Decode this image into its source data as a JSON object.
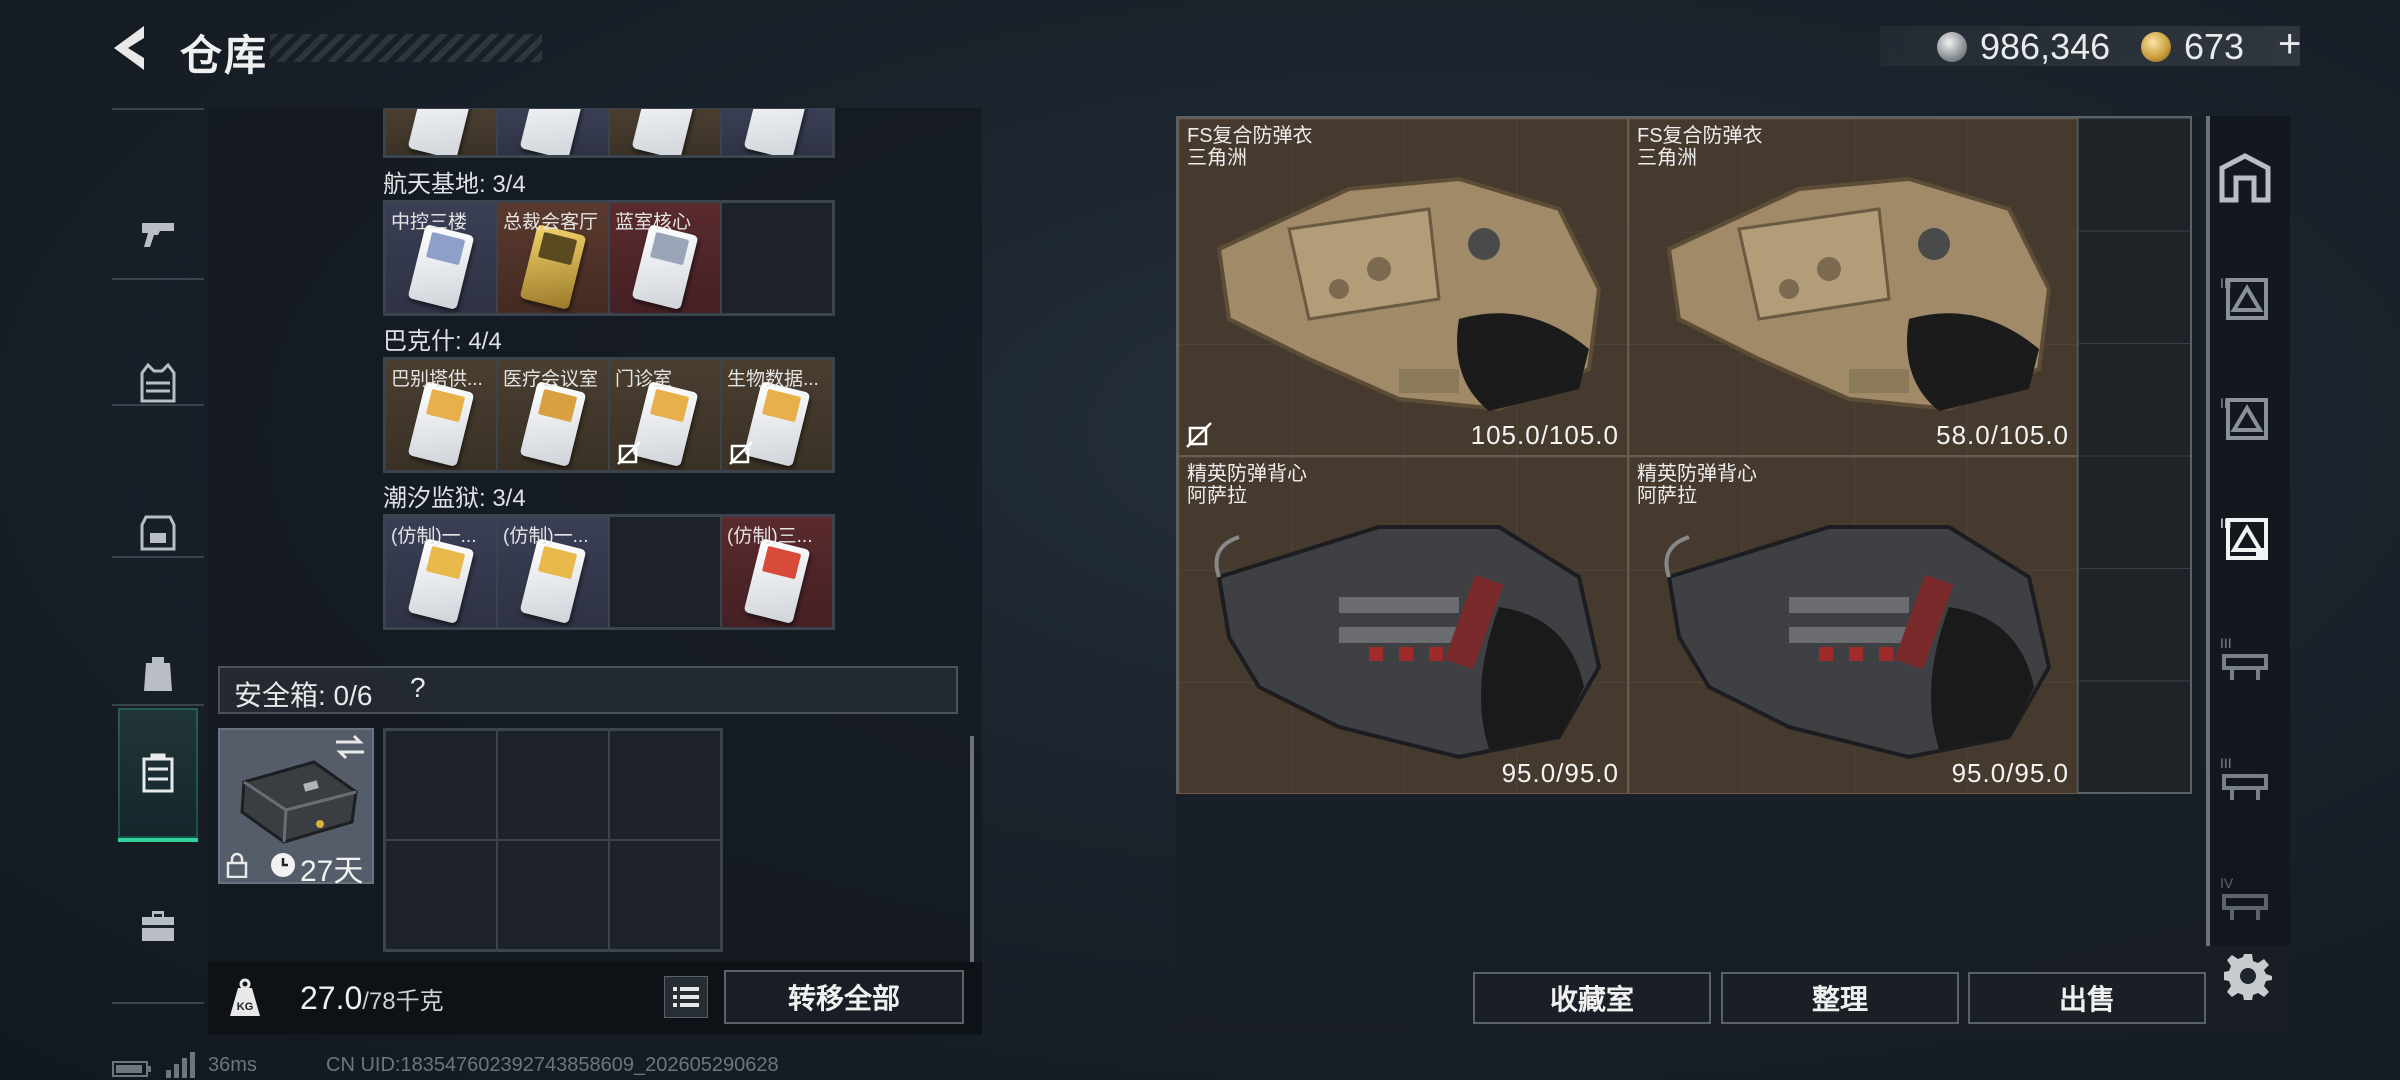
{
  "header": {
    "title": "仓库",
    "silver_amount": "986,346",
    "gold_amount": "673",
    "plus": "+"
  },
  "left_nav": {
    "items": [
      "weapons-icon",
      "armor-vest-icon",
      "chest-rig-icon",
      "backpack-icon",
      "safe-box-icon",
      "toolbox-icon"
    ],
    "active_index": 4
  },
  "keycards": {
    "top_partial_row": [
      "",
      "",
      "",
      ""
    ],
    "groups": [
      {
        "label": "航天基地: 3/4",
        "cells": [
          {
            "name": "中控三楼",
            "color": "blue"
          },
          {
            "name": "总裁会客厅",
            "color": "gold"
          },
          {
            "name": "蓝室核心",
            "color": "red"
          },
          {
            "name": "",
            "color": "empty"
          }
        ]
      },
      {
        "label": "巴克什: 4/4",
        "cells": [
          {
            "name": "巴别塔供...",
            "color": "gold"
          },
          {
            "name": "医疗会议室",
            "color": "gold"
          },
          {
            "name": "门诊室",
            "color": "gold"
          },
          {
            "name": "生物数据...",
            "color": "gold"
          }
        ]
      },
      {
        "label": "潮汐监狱: 3/4",
        "cells": [
          {
            "name": "(仿制)一...",
            "color": "blue"
          },
          {
            "name": "(仿制)一...",
            "color": "blue"
          },
          {
            "name": "",
            "color": "empty"
          },
          {
            "name": "(仿制)三...",
            "color": "red"
          }
        ]
      }
    ]
  },
  "safe": {
    "title": "安全箱: 0/6",
    "help": "?",
    "days": "27天"
  },
  "footer": {
    "weight": "27.0",
    "weight_max": "/78千克",
    "transfer_all": "转移全部"
  },
  "stash": {
    "items": [
      {
        "name": "FS复合防弹衣",
        "sub": "三角洲",
        "durability": "105.0/105.0",
        "type": "tan-vest",
        "unlinked": true
      },
      {
        "name": "FS复合防弹衣",
        "sub": "三角洲",
        "durability": "58.0/105.0",
        "type": "tan-vest",
        "unlinked": false
      },
      {
        "name": "精英防弹背心",
        "sub": "阿萨拉",
        "durability": "95.0/95.0",
        "type": "black-vest",
        "unlinked": false
      },
      {
        "name": "精英防弹背心",
        "sub": "阿萨拉",
        "durability": "95.0/95.0",
        "type": "black-vest",
        "unlinked": false
      }
    ]
  },
  "buttons": {
    "vault": "收藏室",
    "sort": "整理",
    "sell": "出售"
  },
  "right_nav": [
    "home-icon",
    "armor-tier-icon",
    "armor-tier-icon",
    "armor-tier-active-icon",
    "rig-tier-icon",
    "rig-tier-icon",
    "rig-tier-iv-icon"
  ],
  "status": {
    "ping": "36ms",
    "uid": "CN UID:18354760239274385860​9_202605290628"
  }
}
